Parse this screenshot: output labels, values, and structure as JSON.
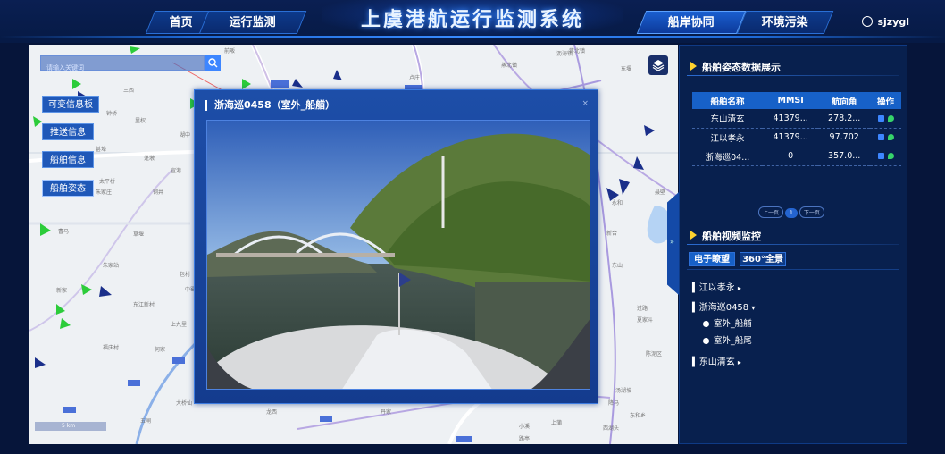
{
  "header": {
    "title": "上虞港航运行监测系统",
    "nav_left": [
      "首页",
      "运行监测"
    ],
    "nav_right": [
      "船岸协同",
      "环境污染"
    ],
    "user": "sjzygl"
  },
  "map": {
    "search_placeholder": "请输入关键词",
    "side_buttons": [
      "可变信息板",
      "推送信息",
      "船舶信息",
      "船舶姿态"
    ],
    "scale": "5 km",
    "place_labels": [
      "前畈",
      "蒸北镇",
      "卢庄",
      "三西",
      "钟桥",
      "里权",
      "湖中",
      "甚埠",
      "蓬墩",
      "宣港",
      "太平桥",
      "朱家庄",
      "钢井",
      "曹马",
      "草堰",
      "朱家站",
      "包村",
      "中蜀",
      "新家",
      "上九里",
      "东江新村",
      "福庆村",
      "何家",
      "大桥仙",
      "龙西",
      "五闸",
      "丹家",
      "上蒲",
      "小溪",
      "西湖头",
      "沥海镇",
      "东堰",
      "蒋北镇",
      "永和",
      "新合",
      "东山",
      "过路",
      "夏家斗",
      "陈泥区",
      "汤湖坡",
      "降马",
      "东和乡",
      "聂壁",
      "路亭"
    ]
  },
  "modal": {
    "title": "浙海巡0458（室外_船艏）",
    "close": "×"
  },
  "panel": {
    "section1_title": "船舶姿态数据展示",
    "table": {
      "headers": [
        "船舶名称",
        "MMSI",
        "航向角",
        "操作"
      ],
      "rows": [
        [
          "东山清玄",
          "41379...",
          "278.2..."
        ],
        [
          "江以孝永",
          "41379...",
          "97.702"
        ],
        [
          "浙海巡04...",
          "0",
          "357.0..."
        ]
      ]
    },
    "pager": {
      "prev": "上一页",
      "page": "1",
      "next": "下一页"
    },
    "section2_title": "船舶视频监控",
    "video_tabs": [
      "电子瞭望",
      "360°全景"
    ],
    "tree": [
      {
        "label": "江以孝永",
        "arrow": "▸"
      },
      {
        "label": "浙海巡0458",
        "arrow": "▾",
        "children": [
          "室外_船艏",
          "室外_船尾"
        ]
      },
      {
        "label": "东山清玄",
        "arrow": "▸"
      }
    ]
  },
  "colors": {
    "accent": "#1761c8",
    "bg": "#06153a",
    "icon_blue": "#3d86ff",
    "icon_green": "#36d46a"
  }
}
